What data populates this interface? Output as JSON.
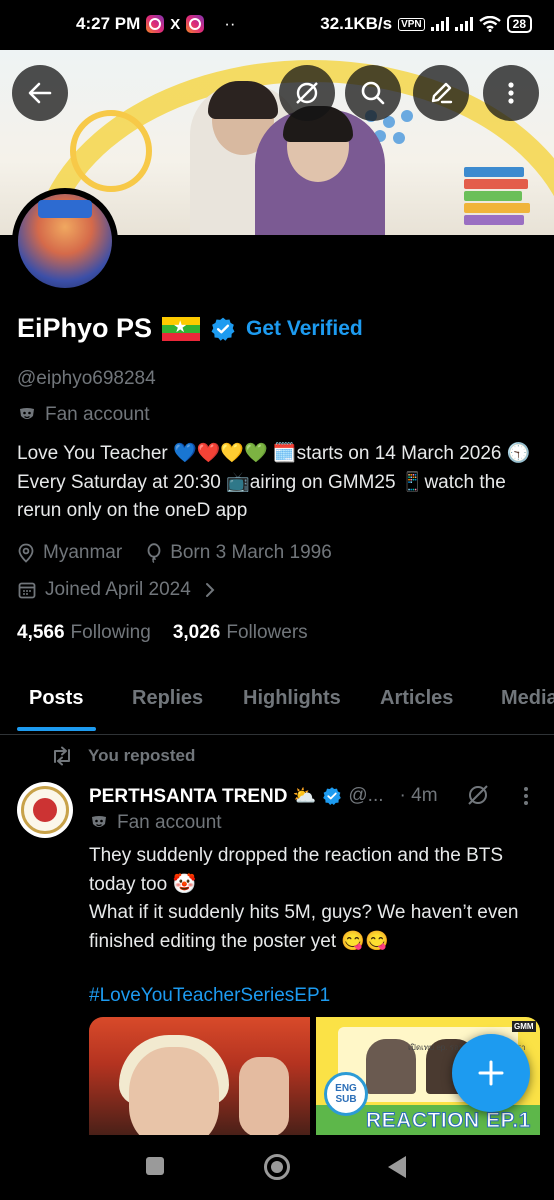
{
  "status_bar": {
    "time": "4:27 PM",
    "x_label": "X",
    "dots": "··",
    "net_speed": "32.1KB/s",
    "vpn_label": "VPN",
    "battery": "28"
  },
  "header": {
    "back_icon": "arrow-left-icon",
    "actions": [
      "no-sync-icon",
      "search-icon",
      "edit-icon",
      "more-vertical-icon"
    ]
  },
  "profile": {
    "name": "EiPhyo PS",
    "flag_icon": "myanmar-flag",
    "verified_icon": "verified-badge",
    "get_verified": "Get Verified",
    "handle": "@eiphyo698284",
    "label": "Fan account",
    "bio": "Love You Teacher 💙❤️💛💚 🗓️starts on 14 March 2026 🕤 Every Saturday at 20:30 📺airing on GMM25 📱watch the rerun only on the oneD app",
    "location": "Myanmar",
    "birthday": "Born 3 March 1996",
    "joined": "Joined April 2024",
    "following_count": "4,566",
    "following_label": "Following",
    "followers_count": "3,026",
    "followers_label": "Followers"
  },
  "tabs": [
    "Posts",
    "Replies",
    "Highlights",
    "Articles",
    "Media"
  ],
  "post": {
    "repost_label": "You reposted",
    "author": "PERTHSANTA TREND ⛅",
    "handle": "@...",
    "time": "· 4m",
    "label": "Fan account",
    "text": "They suddenly dropped the reaction and the BTS today too 🤡\nWhat if it suddenly hits 5M, guys? We haven’t even finished editing the poster yet 😋😋",
    "hashtag": "#LoveYouTeacherSeriesEP1",
    "media2_badge": "ENG SUB",
    "media2_title": "REACTION EP.1",
    "media2_small": "เปิดเทป ep. รอบรู้ ความลับของเรา",
    "media2_corner": "GMM"
  },
  "fab_icon": "plus-icon",
  "nav": [
    "recents-icon",
    "home-icon",
    "back-icon"
  ],
  "colors": {
    "accent": "#1d9bf0",
    "background": "#000000",
    "text_primary": "#e7e9ea",
    "text_secondary": "#71767b"
  }
}
